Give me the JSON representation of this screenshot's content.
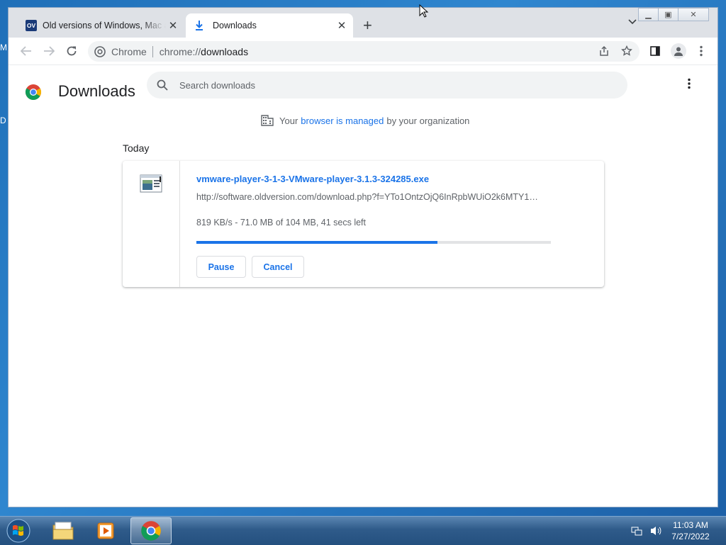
{
  "desktop": {
    "left_letters": [
      "M",
      "D"
    ]
  },
  "browser": {
    "tabs": [
      {
        "title": "Old versions of Windows, Mac and",
        "favicon": "OV",
        "active": false
      },
      {
        "title": "Downloads",
        "favicon": "download-icon",
        "active": true
      }
    ],
    "omnibox": {
      "scheme_label": "Chrome",
      "url_scheme": "chrome://",
      "url_host": "downloads"
    }
  },
  "downloads_page": {
    "title": "Downloads",
    "search_placeholder": "Search downloads",
    "managed_notice": {
      "prefix": "Your",
      "link": "browser is managed",
      "suffix": "by your organization"
    },
    "section_date": "Today",
    "items": [
      {
        "file_name": "vmware-player-3-1-3-VMware-player-3.1.3-324285.exe",
        "url": "http://software.oldversion.com/download.php?f=YTo1OntzOjQ6InRpbWUiO2k6MTY1…",
        "status": "819 KB/s - 71.0 MB of 104 MB, 41 secs left",
        "progress_fraction": 0.68,
        "pause_label": "Pause",
        "cancel_label": "Cancel"
      }
    ]
  },
  "colors": {
    "accent": "#1a73e8",
    "taskbar": "#2f5b8a"
  },
  "taskbar": {
    "clock_time": "11:03 AM",
    "clock_date": "7/27/2022"
  }
}
